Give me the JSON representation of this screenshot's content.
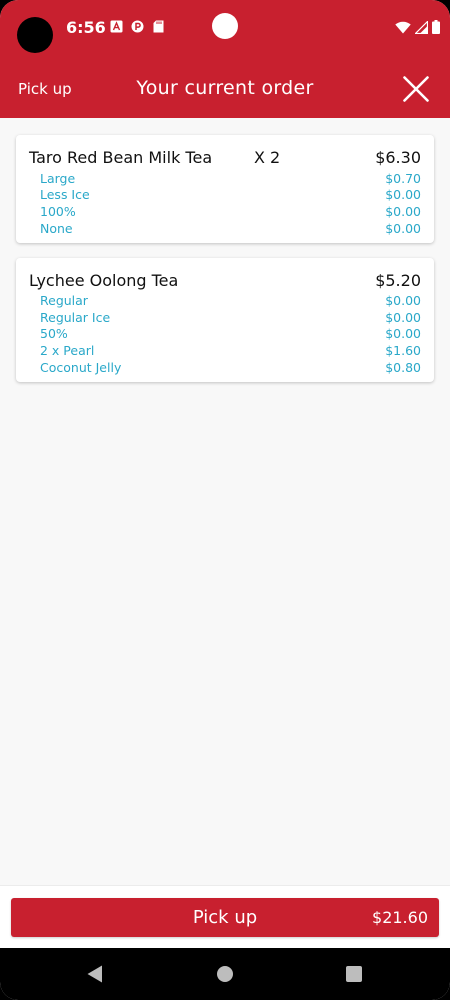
{
  "status_bar": {
    "time": "6:56",
    "notification_icons": [
      "a-icon",
      "p-icon",
      "sd-card-icon"
    ],
    "right_icons": [
      "wifi-icon",
      "signal-icon",
      "battery-icon"
    ]
  },
  "app_bar": {
    "mode_label": "Pick up",
    "title": "Your current order",
    "close_icon": "close-icon"
  },
  "order": {
    "items": [
      {
        "name": "Taro Red Bean Milk Tea",
        "qty": "X 2",
        "price": "$6.30",
        "options": [
          {
            "label": "Large",
            "price": "$0.70"
          },
          {
            "label": "Less Ice",
            "price": "$0.00"
          },
          {
            "label": "100%",
            "price": "$0.00"
          },
          {
            "label": "None",
            "price": "$0.00"
          }
        ]
      },
      {
        "name": "Lychee Oolong Tea",
        "qty": "",
        "price": "$5.20",
        "options": [
          {
            "label": "Regular",
            "price": "$0.00"
          },
          {
            "label": "Regular Ice",
            "price": "$0.00"
          },
          {
            "label": "50%",
            "price": "$0.00"
          },
          {
            "label": "2 x Pearl",
            "price": "$1.60"
          },
          {
            "label": "Coconut Jelly",
            "price": "$0.80"
          }
        ]
      }
    ]
  },
  "bottom": {
    "button_label": "Pick up",
    "total": "$21.60"
  },
  "colors": {
    "brand": "#c8202f",
    "option_text": "#2aa8c9"
  },
  "nav_bar": {
    "icons": [
      "back-icon",
      "home-icon",
      "recents-icon"
    ]
  }
}
